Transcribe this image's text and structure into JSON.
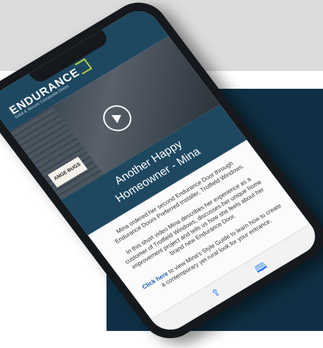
{
  "header": {
    "brand": "ENDURANCE",
    "tagline": "Solid & Secure Composite Doors"
  },
  "video": {
    "sign_text": "ANGE BUGS"
  },
  "article": {
    "title_line1": "Another Happy",
    "title_line2": "Homeowner - Mina",
    "para1": "Mina ordered her second Endurance Door through Endurance Doors Preferred Installer, Trotfield Windows.",
    "para2": "In this short video Mina describes her experience as a customer of Trotfield Windows, discusses her unique home improvement project and tells us how she feels about her brand new Endurance Door.",
    "link_text": "Click here",
    "para3_rest": " to view Mina's Style Guide to learn how to create a contemporary yet rural look for your entrance."
  },
  "toolbar": {
    "share_icon": "share-icon",
    "bookmarks_icon": "book-icon"
  },
  "colors": {
    "brand_navy": "#1e4860",
    "panel_navy": "#0f3044",
    "accent_green": "#b6d23b",
    "link_blue": "#1a5faa"
  }
}
